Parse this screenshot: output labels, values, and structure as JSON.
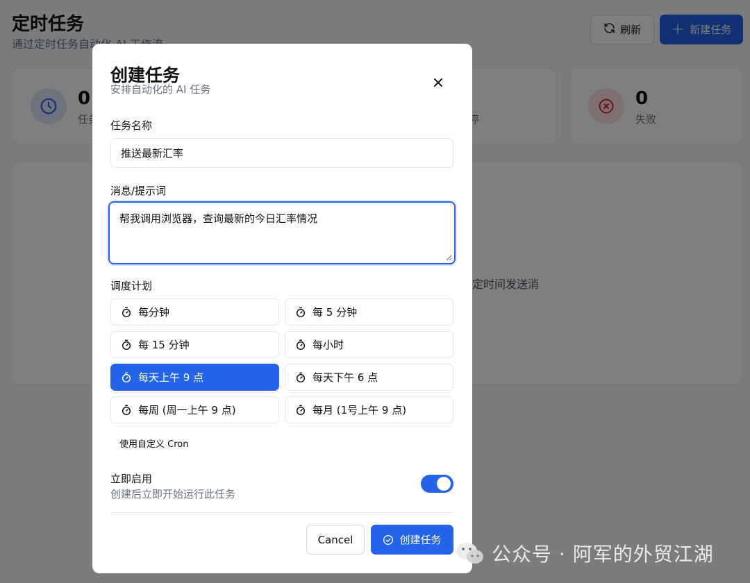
{
  "page": {
    "title": "定时任务",
    "subtitle": "通过定时任务自动化 AI 工作流"
  },
  "header": {
    "refresh_label": "刷新",
    "new_task_label": "新建任务"
  },
  "stats": [
    {
      "value": "0",
      "label": "任务",
      "icon": "clock-icon",
      "color": "#2563eb"
    },
    {
      "value": "",
      "label": "停",
      "icon": "pause-icon",
      "color": "#6b7280"
    },
    {
      "value": "0",
      "label": "失败",
      "icon": "x-circle-icon",
      "color": "#dc2626"
    }
  ],
  "empty_state": {
    "text": "定时间发送消"
  },
  "modal": {
    "title": "创建任务",
    "subtitle": "安排自动化的 AI 任务",
    "name_label": "任务名称",
    "name_value": "推送最新汇率",
    "message_label": "消息/提示词",
    "message_value": "帮我调用浏览器，查询最新的今日汇率情况",
    "schedule_label": "调度计划",
    "schedule_options": [
      {
        "label": "每分钟",
        "active": false
      },
      {
        "label": "每 5 分钟",
        "active": false
      },
      {
        "label": "每 15 分钟",
        "active": false
      },
      {
        "label": "每小时",
        "active": false
      },
      {
        "label": "每天上午 9 点",
        "active": true
      },
      {
        "label": "每天下午 6 点",
        "active": false
      },
      {
        "label": "每周 (周一上午 9 点)",
        "active": false
      },
      {
        "label": "每月 (1号上午 9 点)",
        "active": false
      }
    ],
    "custom_cron_label": "使用自定义 Cron",
    "enable_title": "立即启用",
    "enable_desc": "创建后立即开始运行此任务",
    "enable_on": true,
    "cancel_label": "Cancel",
    "create_label": "创建任务"
  },
  "watermark": {
    "text": "公众号 · 阿军的外贸江湖"
  },
  "colors": {
    "accent": "#2563eb",
    "danger": "#dc2626",
    "muted": "#6b7280"
  }
}
